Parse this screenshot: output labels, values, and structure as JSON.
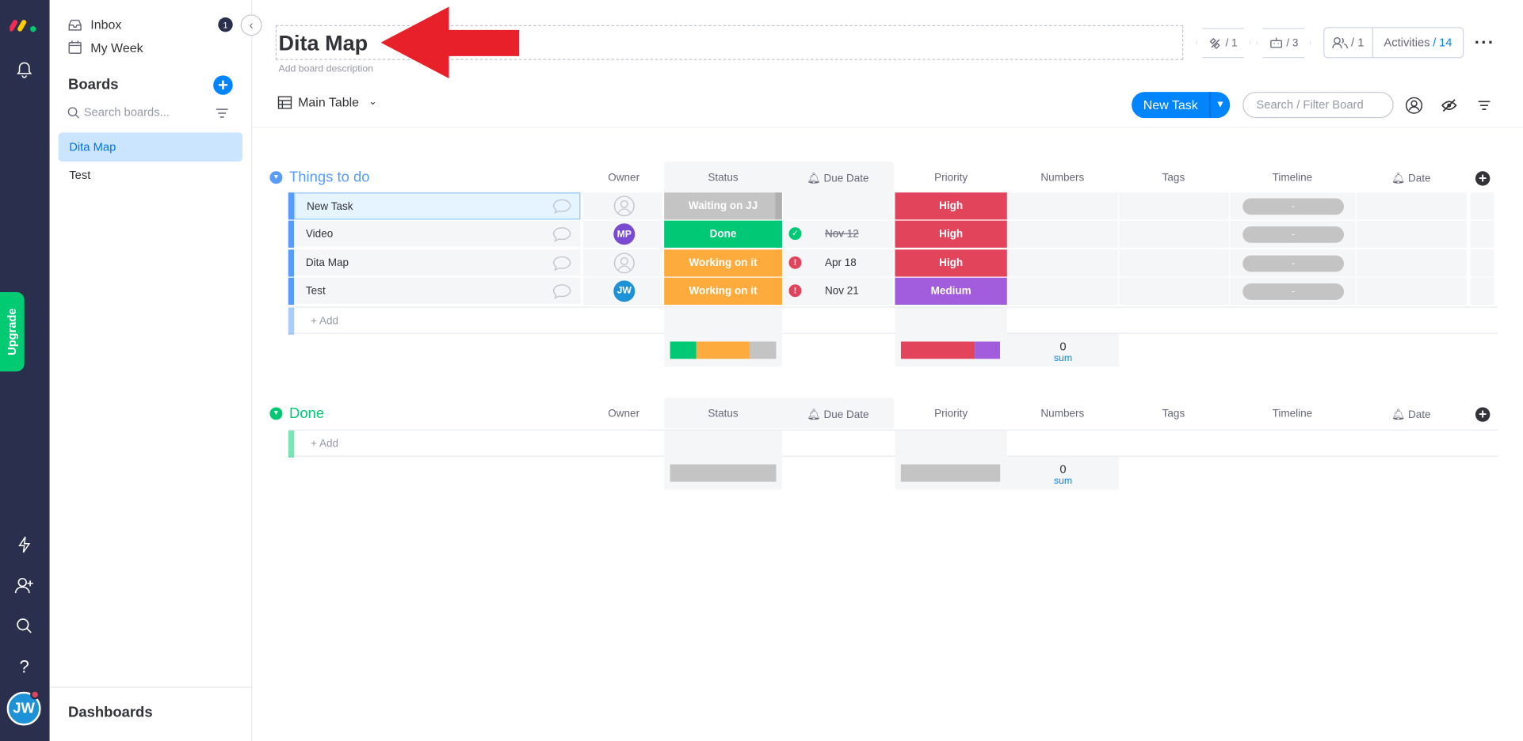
{
  "sidebar": {
    "inbox_label": "Inbox",
    "inbox_count": "1",
    "myweek_label": "My Week",
    "boards_title": "Boards",
    "search_placeholder": "Search boards...",
    "boards": [
      "Dita Map",
      "Test"
    ],
    "dashboards_label": "Dashboards"
  },
  "rail": {
    "upgrade_label": "Upgrade",
    "avatar_initials": "JW"
  },
  "header": {
    "board_title": "Dita Map",
    "description_placeholder": "Add board description",
    "integrations_count": "/ 1",
    "automations_count": "/ 3",
    "members_count": "/ 1",
    "activities_label": "Activities",
    "activities_sep": "/",
    "activities_count": "14",
    "view_label": "Main Table",
    "new_task_label": "New Task",
    "filter_placeholder": "Search / Filter Board"
  },
  "columns": {
    "owner": "Owner",
    "status": "Status",
    "due_date": "Due Date",
    "priority": "Priority",
    "numbers": "Numbers",
    "tags": "Tags",
    "timeline": "Timeline",
    "date": "Date"
  },
  "groups": [
    {
      "title": "Things to do",
      "color": "#579bfc",
      "rows": [
        {
          "name": "New Task",
          "owner": "",
          "owner_color": "",
          "status": "Waiting on JJ",
          "status_color": "#c4c4c4",
          "due": "",
          "due_icon": "",
          "priority": "High",
          "priority_color": "#e2445c",
          "timeline": "-"
        },
        {
          "name": "Video",
          "owner": "MP",
          "owner_color": "#784bd1",
          "status": "Done",
          "status_color": "#00c875",
          "due": "Nov 12",
          "due_icon": "check",
          "priority": "High",
          "priority_color": "#e2445c",
          "timeline": "-"
        },
        {
          "name": "Dita Map",
          "owner": "",
          "owner_color": "",
          "status": "Working on it",
          "status_color": "#fdab3d",
          "due": "Apr 18",
          "due_icon": "alert",
          "priority": "High",
          "priority_color": "#e2445c",
          "timeline": "-"
        },
        {
          "name": "Test",
          "owner": "JW",
          "owner_color": "#1d92d6",
          "status": "Working on it",
          "status_color": "#fdab3d",
          "due": "Nov 21",
          "due_icon": "alert",
          "priority": "Medium",
          "priority_color": "#a25ddc",
          "timeline": "-"
        }
      ],
      "add_label": "+ Add",
      "numbers_sum": "0",
      "sum_label": "sum"
    },
    {
      "title": "Done",
      "color": "#00c875",
      "rows": [],
      "add_label": "+ Add",
      "numbers_sum": "0",
      "sum_label": "sum"
    }
  ],
  "colors": {
    "accent": "#0085ff",
    "rail": "#292f4c",
    "upgrade": "#00ca72",
    "arrow": "#e8202a"
  }
}
